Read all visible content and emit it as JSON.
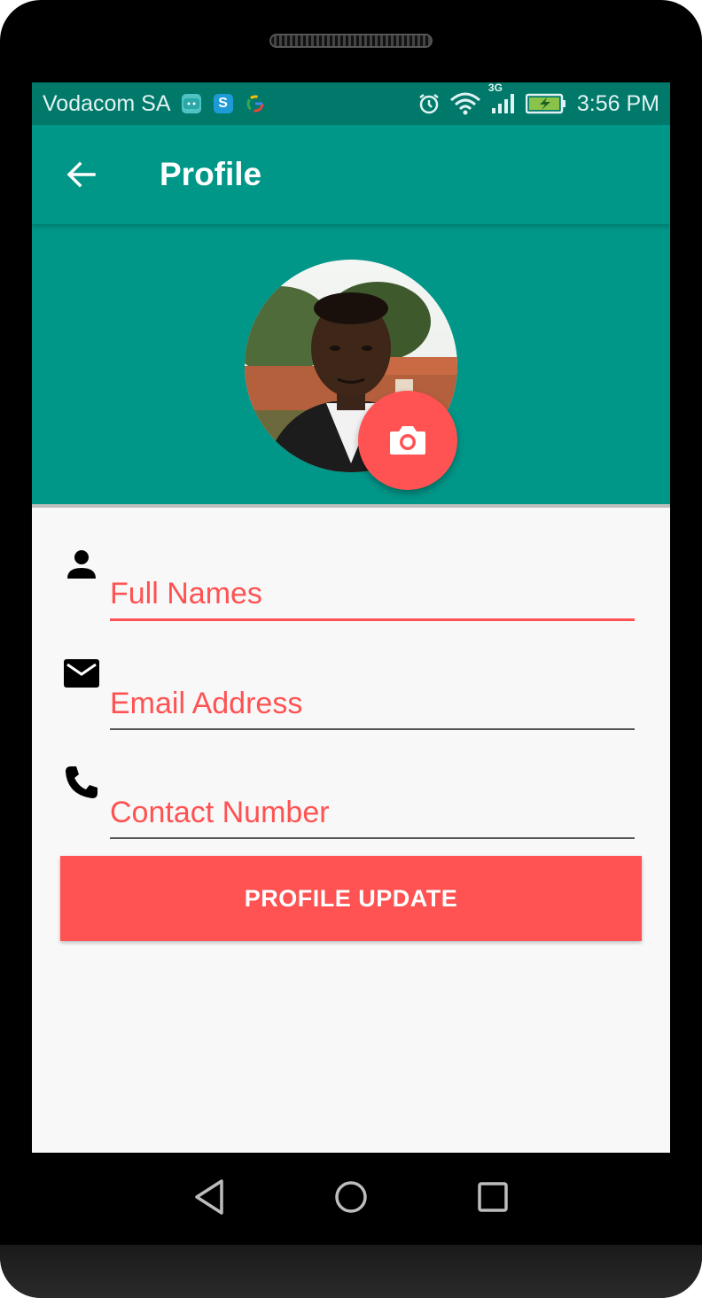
{
  "status_bar": {
    "carrier": "Vodacom SA",
    "network": "3G",
    "time": "3:56 PM",
    "notification_icons": [
      "android-icon",
      "skype-icon",
      "google-icon"
    ],
    "system_icons": [
      "alarm-icon",
      "wifi-icon",
      "signal-icon",
      "battery-charging-icon"
    ]
  },
  "app_bar": {
    "back_icon": "arrow-left-icon",
    "title": "Profile"
  },
  "profile_header": {
    "avatar": "profile-photo",
    "camera_icon": "camera-icon"
  },
  "form": {
    "full_names": {
      "icon": "person-icon",
      "placeholder": "Full Names",
      "value": ""
    },
    "email": {
      "icon": "mail-icon",
      "placeholder": "Email Address",
      "value": ""
    },
    "contact": {
      "icon": "phone-icon",
      "placeholder": "Contact Number",
      "value": ""
    }
  },
  "update_button": {
    "label": "PROFILE UPDATE"
  },
  "nav_bar": {
    "back": "nav-back-icon",
    "home": "nav-home-icon",
    "recents": "nav-recents-icon"
  },
  "colors": {
    "primary": "#009688",
    "primary_dark": "#00796b",
    "accent": "#ff5252",
    "background": "#f8f8f8"
  }
}
